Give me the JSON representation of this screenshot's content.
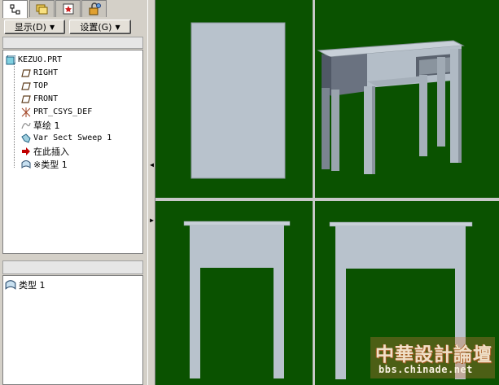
{
  "toolbar": {
    "display_button": "显示(D)",
    "settings_button": "设置(G)"
  },
  "model_tree": {
    "items": [
      {
        "label": "KEZUO.PRT",
        "icon": "part-icon"
      },
      {
        "label": "RIGHT",
        "icon": "datum-plane-icon"
      },
      {
        "label": "TOP",
        "icon": "datum-plane-icon"
      },
      {
        "label": "FRONT",
        "icon": "datum-plane-icon"
      },
      {
        "label": "PRT_CSYS_DEF",
        "icon": "csys-icon"
      },
      {
        "label": "草绘 1",
        "icon": "sketch-icon"
      },
      {
        "label": "Var Sect Sweep 1",
        "icon": "sweep-icon"
      },
      {
        "label": "在此插入",
        "icon": "insert-here-arrow-icon"
      },
      {
        "label": "※类型 1",
        "icon": "type-icon"
      }
    ]
  },
  "detail_list": {
    "items": [
      {
        "label": "类型 1",
        "icon": "type-icon"
      }
    ]
  },
  "watermark": {
    "title": "中華設計論壇",
    "url": "bbs.chinade.net"
  },
  "colors": {
    "viewport_bg": "#0a5200",
    "model_fill": "#b8c2cc",
    "panel_bg": "#d4d0c8",
    "insert_arrow": "#c00000"
  }
}
